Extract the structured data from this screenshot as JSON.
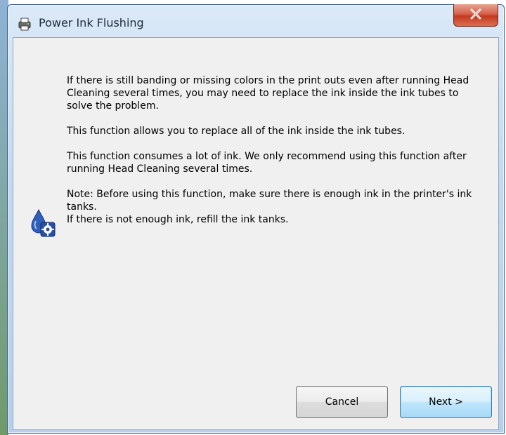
{
  "window": {
    "title": "Power Ink Flushing",
    "title_icon": "printer-gear-icon",
    "close_icon": "close-x-icon"
  },
  "message": {
    "paragraph_1": "If there is still banding or missing colors in the print outs even after running Head Cleaning several times, you may need to replace the ink inside the ink tubes to solve the problem.",
    "paragraph_2": "This function allows you to replace all of the ink inside the ink tubes.",
    "paragraph_3": "This function consumes a lot of ink. We only recommend using this function after running Head Cleaning several times.",
    "note_line_1": "Note: Before using this function, make sure there is enough ink in the printer's ink tanks.",
    "note_line_2": "If there is not enough ink, refill the ink tanks.",
    "note_icon": "ink-drop-gear-icon"
  },
  "buttons": {
    "cancel_label": "Cancel",
    "next_label": "Next >"
  },
  "colors": {
    "titlebar": "#c4d9f0",
    "close_button": "#c4391f",
    "client_background": "#f0f0f0",
    "default_button_border": "#3c7fb1"
  }
}
